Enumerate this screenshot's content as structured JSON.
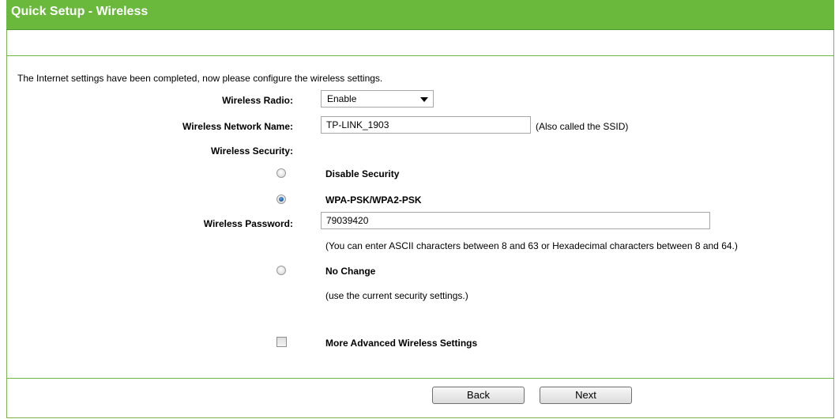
{
  "header": {
    "title": "Quick Setup - Wireless"
  },
  "intro": "The Internet settings have been completed, now please configure the wireless settings.",
  "form": {
    "wireless_radio": {
      "label": "Wireless Radio:",
      "value": "Enable"
    },
    "network_name": {
      "label": "Wireless Network Name:",
      "value": "TP-LINK_1903",
      "note": "(Also called the SSID)"
    },
    "security": {
      "label": "Wireless Security:",
      "options": [
        {
          "label": "Disable Security",
          "checked": false
        },
        {
          "label": "WPA-PSK/WPA2-PSK",
          "checked": true
        },
        {
          "label": "No Change",
          "checked": false
        }
      ],
      "password_label": "Wireless Password:",
      "password_value": "79039420",
      "password_note": "(You can enter ASCII characters between 8 and 63 or Hexadecimal characters between 8 and 64.)",
      "no_change_note": "(use the current security settings.)"
    },
    "advanced": {
      "label": "More Advanced Wireless Settings",
      "checked": false
    }
  },
  "buttons": {
    "back": "Back",
    "next": "Next"
  },
  "colors": {
    "header_green": "#6ab93c",
    "border_green": "#7fb24a"
  }
}
